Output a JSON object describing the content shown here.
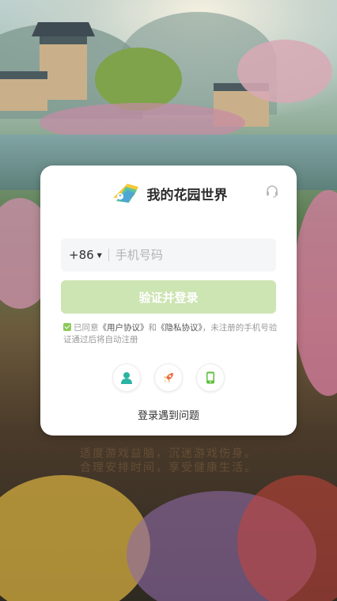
{
  "app": {
    "name": "我的花园世界"
  },
  "login": {
    "country_code": "+86",
    "phone_placeholder": "手机号码",
    "submit_label": "验证并登录",
    "agreement": {
      "prefix": "已同意",
      "user_agreement": "《用户协议》",
      "and": "和",
      "privacy_policy": "《隐私协议》",
      "suffix": "，未注册的手机号验证通过后将自动注册"
    },
    "methods": [
      {
        "icon": "user-icon",
        "color": "#2bb3a3"
      },
      {
        "icon": "rocket-icon",
        "color": "#f06a3a"
      },
      {
        "icon": "phone-icon",
        "color": "#5cbf3a"
      }
    ],
    "help_label": "登录遇到问题"
  },
  "background_notice": {
    "line1": "适度游戏益脑，沉迷游戏伤身。",
    "line2": "合理安排时间，享受健康生活。"
  },
  "colors": {
    "accent": "#8cc95a",
    "button_disabled": "#cde4b3",
    "input_bg": "#f4f6f7"
  }
}
